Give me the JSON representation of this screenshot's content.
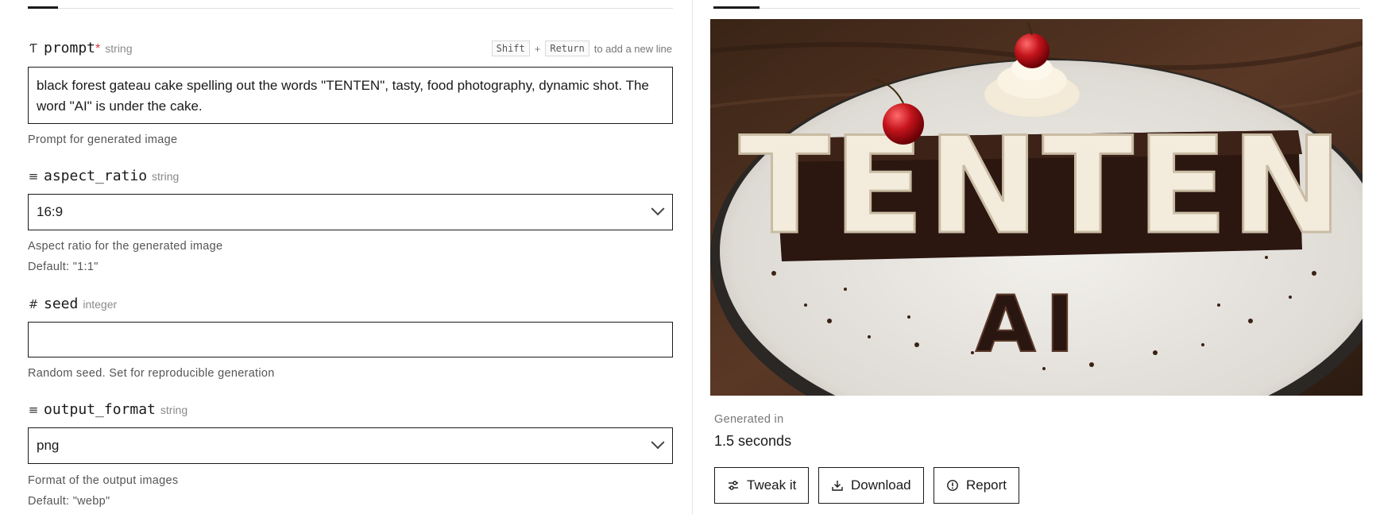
{
  "form": {
    "prompt": {
      "name": "prompt",
      "required_mark": "*",
      "type": "string",
      "icon": "text-type-icon",
      "value": "black forest gateau cake spelling out the words \"TENTEN\", tasty, food photography, dynamic shot. The word \"AI\" is under the cake.",
      "help": "Prompt for generated image",
      "hint": {
        "key1": "Shift",
        "plus": "+",
        "key2": "Return",
        "text": "to add a new line"
      }
    },
    "aspect_ratio": {
      "name": "aspect_ratio",
      "type": "string",
      "icon": "list-icon",
      "value": "16:9",
      "help": "Aspect ratio for the generated image",
      "default": "Default: \"1:1\""
    },
    "seed": {
      "name": "seed",
      "type": "integer",
      "icon": "hash-icon",
      "value": "",
      "help": "Random seed. Set for reproducible generation"
    },
    "output_format": {
      "name": "output_format",
      "type": "string",
      "icon": "list-icon",
      "value": "png",
      "help": "Format of the output images",
      "default": "Default: \"webp\""
    }
  },
  "output": {
    "image_caption": "TENTEN",
    "image_subcaption": "AI",
    "generated_label": "Generated in",
    "generated_value": "1.5 seconds",
    "buttons": {
      "tweak": "Tweak it",
      "download": "Download",
      "report": "Report"
    }
  },
  "colors": {
    "border": "#1a1a1a",
    "required": "#d9363e",
    "muted": "#8a8a8a"
  }
}
